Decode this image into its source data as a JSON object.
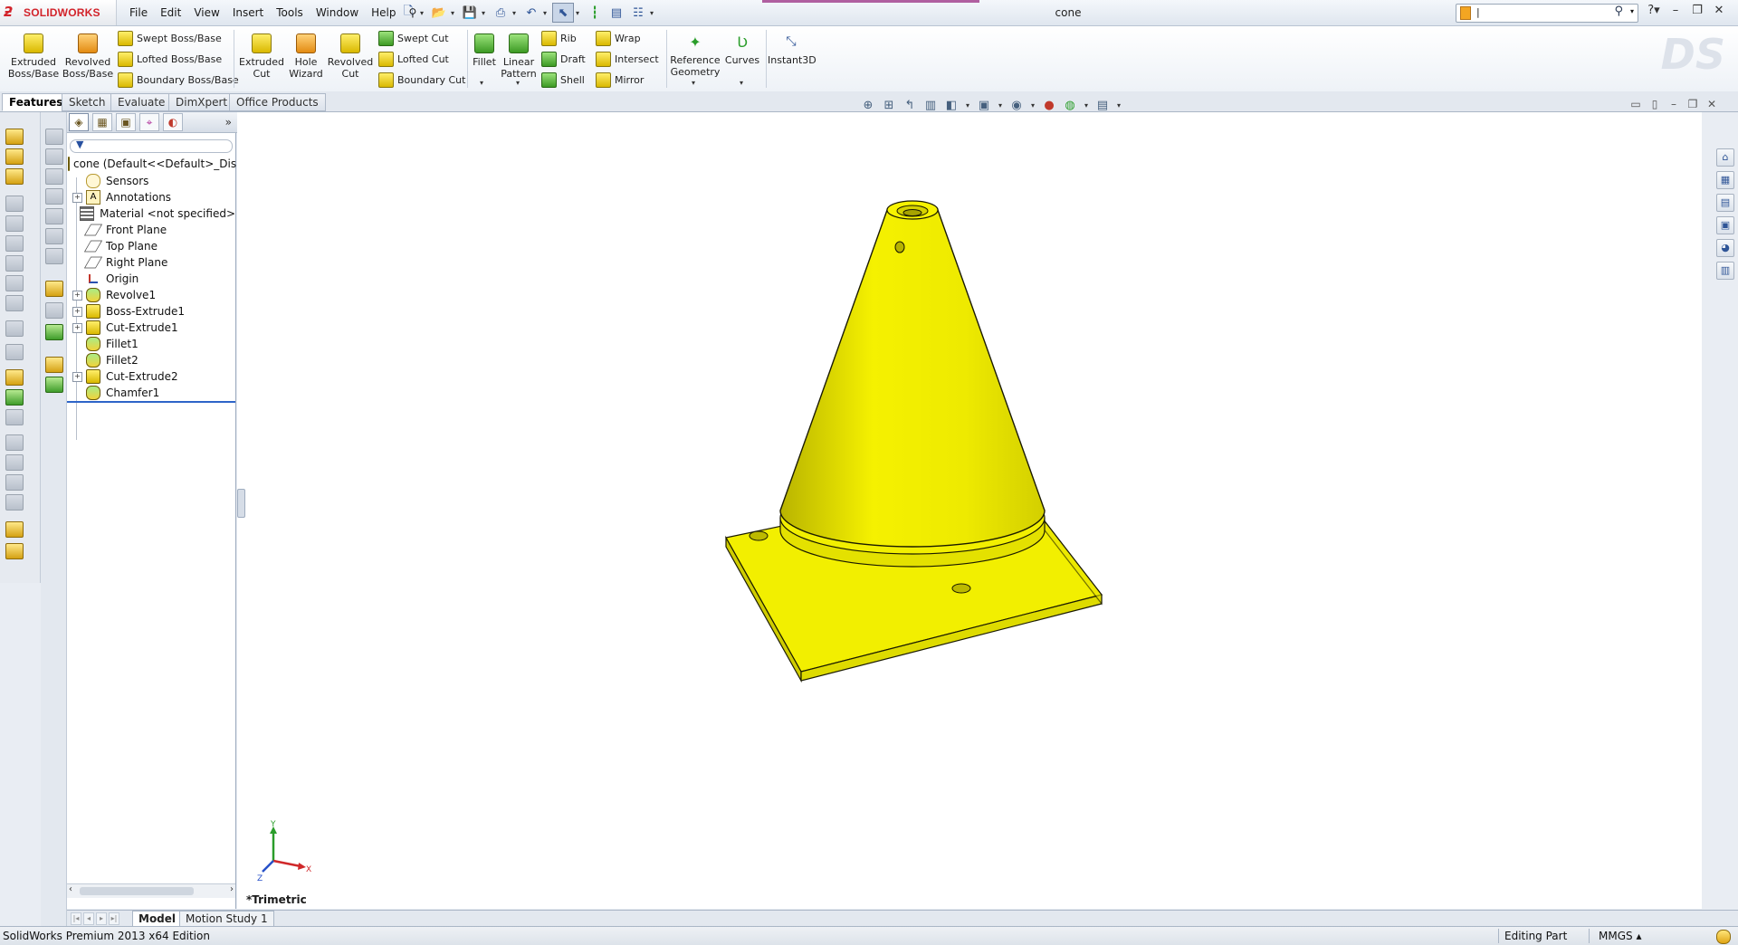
{
  "app": {
    "name": "SOLIDWORKS",
    "doc_title": "cone"
  },
  "menu": [
    "File",
    "Edit",
    "View",
    "Insert",
    "Tools",
    "Window",
    "Help"
  ],
  "commands": {
    "extruded_boss": "Extruded Boss/Base",
    "revolved_boss": "Revolved Boss/Base",
    "swept_boss": "Swept Boss/Base",
    "lofted_boss": "Lofted Boss/Base",
    "boundary_boss": "Boundary Boss/Base",
    "extruded_cut": "Extruded Cut",
    "hole_wizard": "Hole Wizard",
    "revolved_cut": "Revolved Cut",
    "swept_cut": "Swept Cut",
    "lofted_cut": "Lofted Cut",
    "boundary_cut": "Boundary Cut",
    "fillet": "Fillet",
    "linear_pattern": "Linear Pattern",
    "rib": "Rib",
    "draft": "Draft",
    "shell": "Shell",
    "wrap": "Wrap",
    "intersect": "Intersect",
    "mirror": "Mirror",
    "reference_geometry": "Reference Geometry",
    "curves": "Curves",
    "instant3d": "Instant3D"
  },
  "cm_tabs": [
    "Features",
    "Sketch",
    "Evaluate",
    "DimXpert",
    "Office Products"
  ],
  "tree": {
    "root": "cone  (Default<<Default>_Disp",
    "items": [
      {
        "label": "Sensors",
        "icon": "sensor-icon",
        "expandable": false
      },
      {
        "label": "Annotations",
        "icon": "annotations-icon",
        "expandable": true
      },
      {
        "label": "Material <not specified>",
        "icon": "material-icon",
        "expandable": false
      },
      {
        "label": "Front Plane",
        "icon": "plane-icon",
        "expandable": false
      },
      {
        "label": "Top Plane",
        "icon": "plane-icon",
        "expandable": false
      },
      {
        "label": "Right Plane",
        "icon": "plane-icon",
        "expandable": false
      },
      {
        "label": "Origin",
        "icon": "origin-icon",
        "expandable": false
      },
      {
        "label": "Revolve1",
        "icon": "revolve-icon",
        "expandable": true
      },
      {
        "label": "Boss-Extrude1",
        "icon": "extrude-icon",
        "expandable": true
      },
      {
        "label": "Cut-Extrude1",
        "icon": "cut-extrude-icon",
        "expandable": true
      },
      {
        "label": "Fillet1",
        "icon": "fillet-icon",
        "expandable": false
      },
      {
        "label": "Fillet2",
        "icon": "fillet-icon",
        "expandable": false
      },
      {
        "label": "Cut-Extrude2",
        "icon": "cut-extrude-icon",
        "expandable": true
      },
      {
        "label": "Chamfer1",
        "icon": "chamfer-icon",
        "expandable": false
      }
    ]
  },
  "viewport": {
    "view_name": "*Trimetric",
    "model_color": "#f2ef00",
    "axes": {
      "x": "X",
      "y": "Y",
      "z": "Z"
    }
  },
  "bottom_tabs": [
    "Model",
    "Motion Study 1"
  ],
  "status": {
    "left": "SolidWorks Premium 2013 x64 Edition",
    "mode": "Editing Part",
    "units": "MMGS"
  }
}
